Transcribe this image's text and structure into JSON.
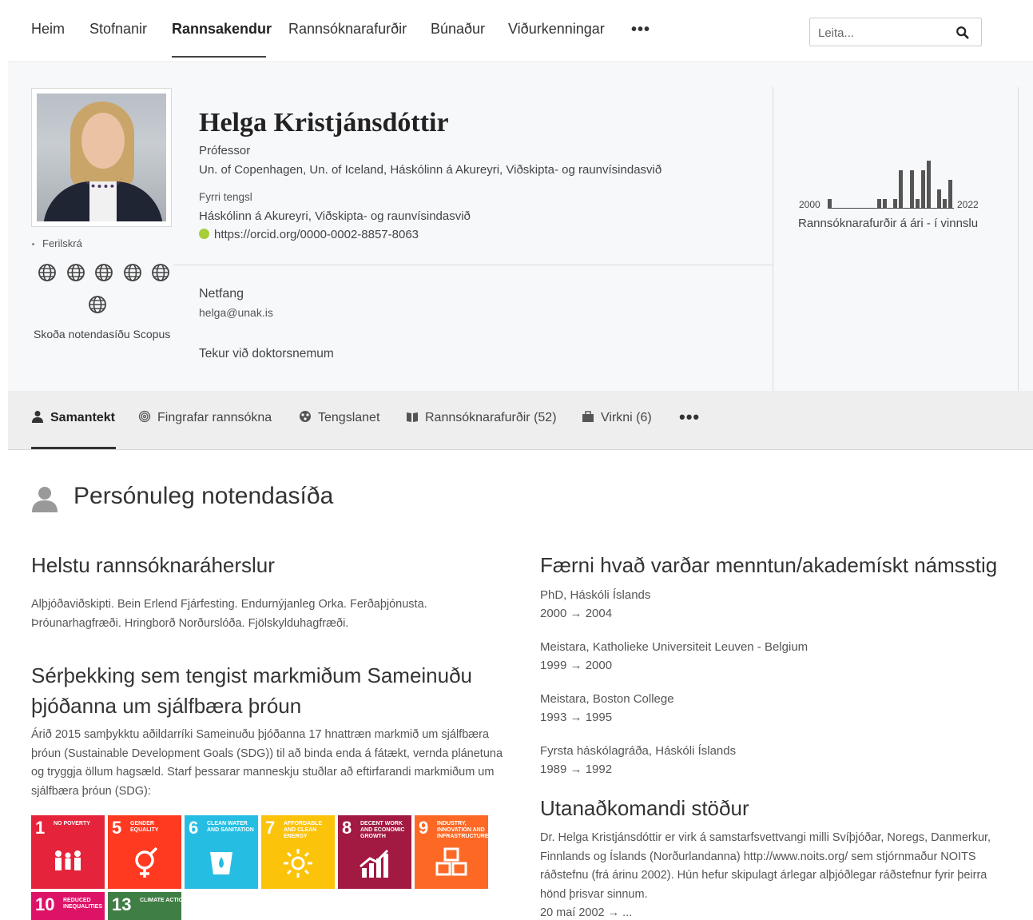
{
  "topnav": {
    "items": [
      {
        "label": "Heim"
      },
      {
        "label": "Stofnanir"
      },
      {
        "label": "Rannsakendur"
      },
      {
        "label": "Rannsóknarafurðir"
      },
      {
        "label": "Búnaður"
      },
      {
        "label": "Viðurkenningar"
      }
    ],
    "more_label": "•••",
    "search_placeholder": "Leita..."
  },
  "profile": {
    "name": "Helga Kristjánsdóttir",
    "title": "Prófessor",
    "affiliations": "Un. of Copenhagen, Un. of Iceland, Háskólinn á Akureyri, Viðskipta- og raunvísindasvið",
    "former_label": "Fyrri tengsl",
    "former_affiliation": "Háskólinn á Akureyri, Viðskipta- og raunvísindasvið",
    "orcid": "https://orcid.org/0000-0002-8857-8063",
    "email_label": "Netfang",
    "email": "helga@unak.is",
    "phd_note": "Tekur við doktorsnemum",
    "cv_label": "Ferilskrá",
    "scopus_label": "Skoða notendasíðu Scopus"
  },
  "output_chart": {
    "start_year": "2000",
    "end_year": "2022",
    "caption": "Rannsóknarafurðir á ári - í vinnslu"
  },
  "chart_data": {
    "type": "bar",
    "categories": [
      "2000",
      "2001",
      "2002",
      "2003",
      "2004",
      "2005",
      "2006",
      "2007",
      "2008",
      "2009",
      "2010",
      "2011",
      "2012",
      "2013",
      "2014",
      "2015",
      "2016",
      "2017",
      "2018",
      "2019",
      "2020",
      "2021",
      "2022"
    ],
    "values": [
      1,
      0,
      0,
      0,
      0,
      0,
      0,
      0,
      0,
      1,
      1,
      0,
      1,
      4,
      0,
      4,
      1,
      4,
      5,
      0,
      2,
      1,
      3
    ],
    "xlabel": "",
    "ylabel": ""
  },
  "subtabs": [
    {
      "label": "Samantekt",
      "icon": "user-icon"
    },
    {
      "label": "Fingrafar rannsókna",
      "icon": "fingerprint-icon"
    },
    {
      "label": "Tengslanet",
      "icon": "network-icon"
    },
    {
      "label": "Rannsóknarafurðir (52)",
      "icon": "book-icon"
    },
    {
      "label": "Virkni (6)",
      "icon": "briefcase-icon"
    }
  ],
  "main": {
    "page_title": "Persónuleg notendasíða",
    "research_heading": "Helstu rannsóknaráherslur",
    "research_text": "Alþjóðaviðskipti. Bein Erlend Fjárfesting. Endurnýjanleg Orka. Ferðaþjónusta. Þróunarhagfræði. Hringborð Norðurslóða. Fjölskylduhagfræði.",
    "sdg_heading": "Sérþekking sem tengist markmiðum Sameinuðu þjóðanna um sjálfbæra þróun",
    "sdg_text": "Árið 2015 samþykktu aðildarríki Sameinuðu þjóðanna 17 hnattræn markmið um sjálfbæra þróun (Sustainable Development Goals (SDG)) til að binda enda á fátækt, vernda plánetuna og tryggja öllum hagsæld. Starf þessarar manneskju stuðlar að eftirfarandi markmiðum um sjálfbæra þróun (SDG):",
    "education_heading": "Færni hvað varðar menntun/akademískt námsstig",
    "education": [
      {
        "degree": "PhD, Háskóli Íslands",
        "years": "2000 → 2004"
      },
      {
        "degree": "Meistara, Katholieke Universiteit Leuven - Belgium",
        "years": "1999 → 2000"
      },
      {
        "degree": "Meistara, Boston College",
        "years": "1993 → 1995"
      },
      {
        "degree": "Fyrsta háskólagráða, Háskóli Íslands",
        "years": "1989 → 1992"
      }
    ],
    "external_heading": "Utanaðkomandi stöður",
    "external_text": "Dr. Helga Kristjánsdóttir er virk á samstarfsvettvangi milli Svíþjóðar, Noregs, Danmerkur, Finnlands og Íslands (Norðurlandanna) http://www.noits.org/ sem stjórnmaður NOITS ráðstefnu (frá árinu 2002). Hún hefur skipulagt árlegar alþjóðlegar ráðstefnur fyrir þeirra hönd þrisvar sinnum.",
    "external_period": "20 maí 2002 → ..."
  },
  "sdgs": [
    {
      "num": "1",
      "label": "No poverty",
      "color": "#e5243b",
      "icon": "family-icon"
    },
    {
      "num": "5",
      "label": "Gender equality",
      "color": "#ff3a21",
      "icon": "gender-icon"
    },
    {
      "num": "6",
      "label": "Clean water and sanitation",
      "color": "#26bde2",
      "icon": "water-icon"
    },
    {
      "num": "7",
      "label": "Affordable and clean energy",
      "color": "#fcc30b",
      "icon": "sun-icon"
    },
    {
      "num": "8",
      "label": "Decent work and economic growth",
      "color": "#a21942",
      "icon": "growth-icon"
    },
    {
      "num": "9",
      "label": "Industry, innovation and infrastructure",
      "color": "#fd6925",
      "icon": "cubes-icon"
    },
    {
      "num": "10",
      "label": "Reduced inequalities",
      "color": "#dd1367",
      "icon": "arrows-icon"
    },
    {
      "num": "13",
      "label": "Climate action",
      "color": "#3f7e44",
      "icon": "eye-icon"
    }
  ]
}
